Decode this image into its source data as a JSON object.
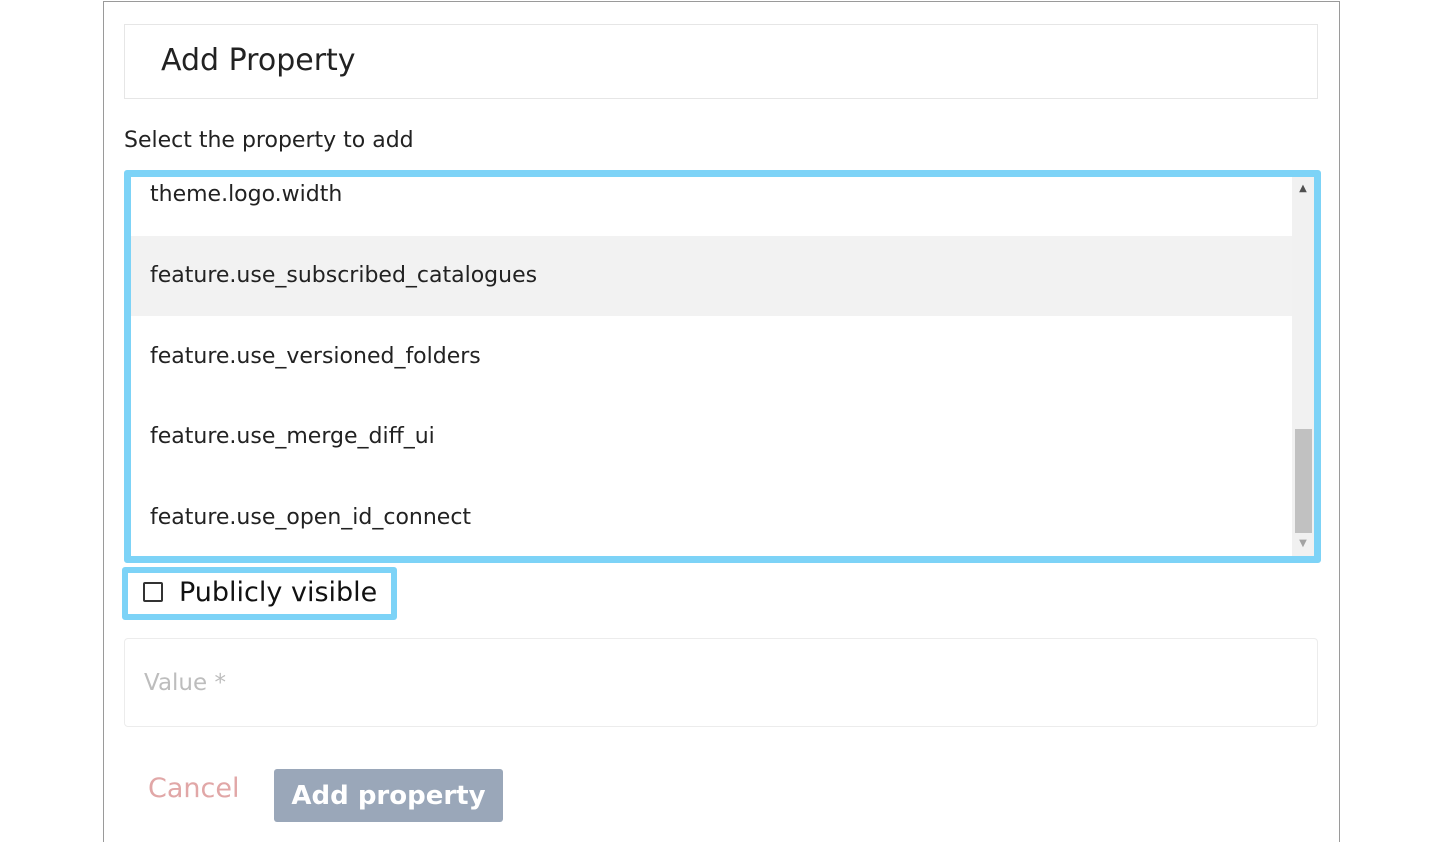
{
  "dialog": {
    "title": "Add Property",
    "select_label": "Select the property to add",
    "options": [
      "theme.logo.width",
      "feature.use_subscribed_catalogues",
      "feature.use_versioned_folders",
      "feature.use_merge_diff_ui",
      "feature.use_open_id_connect"
    ],
    "highlighted_option": "feature.use_subscribed_catalogues",
    "publicly_visible_label": "Publicly visible",
    "publicly_visible_checked": false,
    "value_field": {
      "placeholder": "Value *",
      "value": ""
    },
    "cancel_label": "Cancel",
    "add_label": "Add property"
  },
  "colors": {
    "highlight_border": "#7dd3f7",
    "add_button_bg": "#9aa7b9",
    "cancel_text": "#e1a7a7"
  },
  "icons": {
    "scroll_up": "scroll-up-arrow-icon",
    "scroll_down": "scroll-down-arrow-icon",
    "checkbox": "checkbox-unchecked-icon"
  }
}
